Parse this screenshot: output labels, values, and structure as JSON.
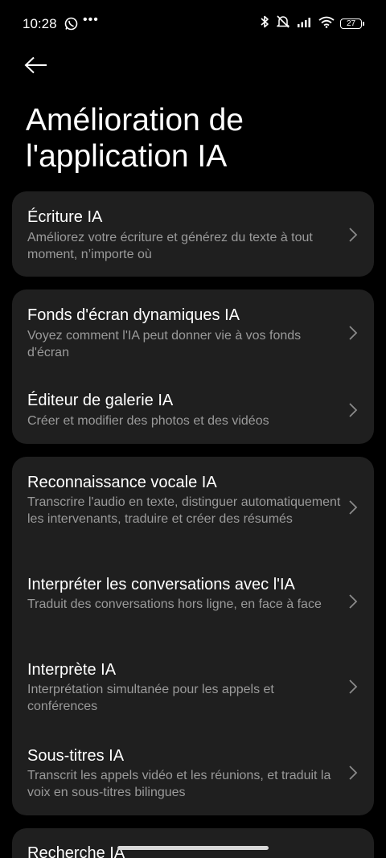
{
  "status_bar": {
    "time": "10:28",
    "battery_level": "27",
    "icons": [
      "whatsapp-icon",
      "more-dots-icon",
      "bluetooth-icon",
      "vibrate-off-icon",
      "signal-icon",
      "wifi-icon",
      "battery-icon"
    ]
  },
  "header": {
    "back_icon": "arrow-left-icon",
    "title": "Amélioration de l'application IA"
  },
  "groups": [
    {
      "items": [
        {
          "title": "Écriture IA",
          "description": "Améliorez votre écriture et générez du texte à tout moment, n’importe où"
        }
      ]
    },
    {
      "items": [
        {
          "title": "Fonds d'écran dynamiques IA",
          "description": "Voyez comment l'IA peut donner vie à vos fonds d'écran"
        },
        {
          "title": "Éditeur de galerie IA",
          "description": "Créer et modifier des photos et des vidéos"
        }
      ]
    },
    {
      "items": [
        {
          "title": "Reconnaissance vocale IA",
          "description": "Transcrire l'audio en texte, distinguer automatiquement les intervenants, traduire et créer des résumés"
        },
        {
          "title": "Interpréter les conversations avec l'IA",
          "description": "Traduit des conversations hors ligne, en face à face"
        },
        {
          "title": "Interprète IA",
          "description": "Interprétation simultanée pour les appels et conférences"
        },
        {
          "title": "Sous-titres IA",
          "description": "Transcrit les appels vidéo et les réunions, et traduit la voix en sous-titres bilingues"
        }
      ]
    },
    {
      "items": [
        {
          "title": "Recherche IA"
        }
      ]
    }
  ],
  "colors": {
    "background": "#000000",
    "card": "#1f1f1f",
    "title_text": "#ffffff",
    "description_text": "#9a9a9a",
    "chevron": "#8a8a8a"
  }
}
